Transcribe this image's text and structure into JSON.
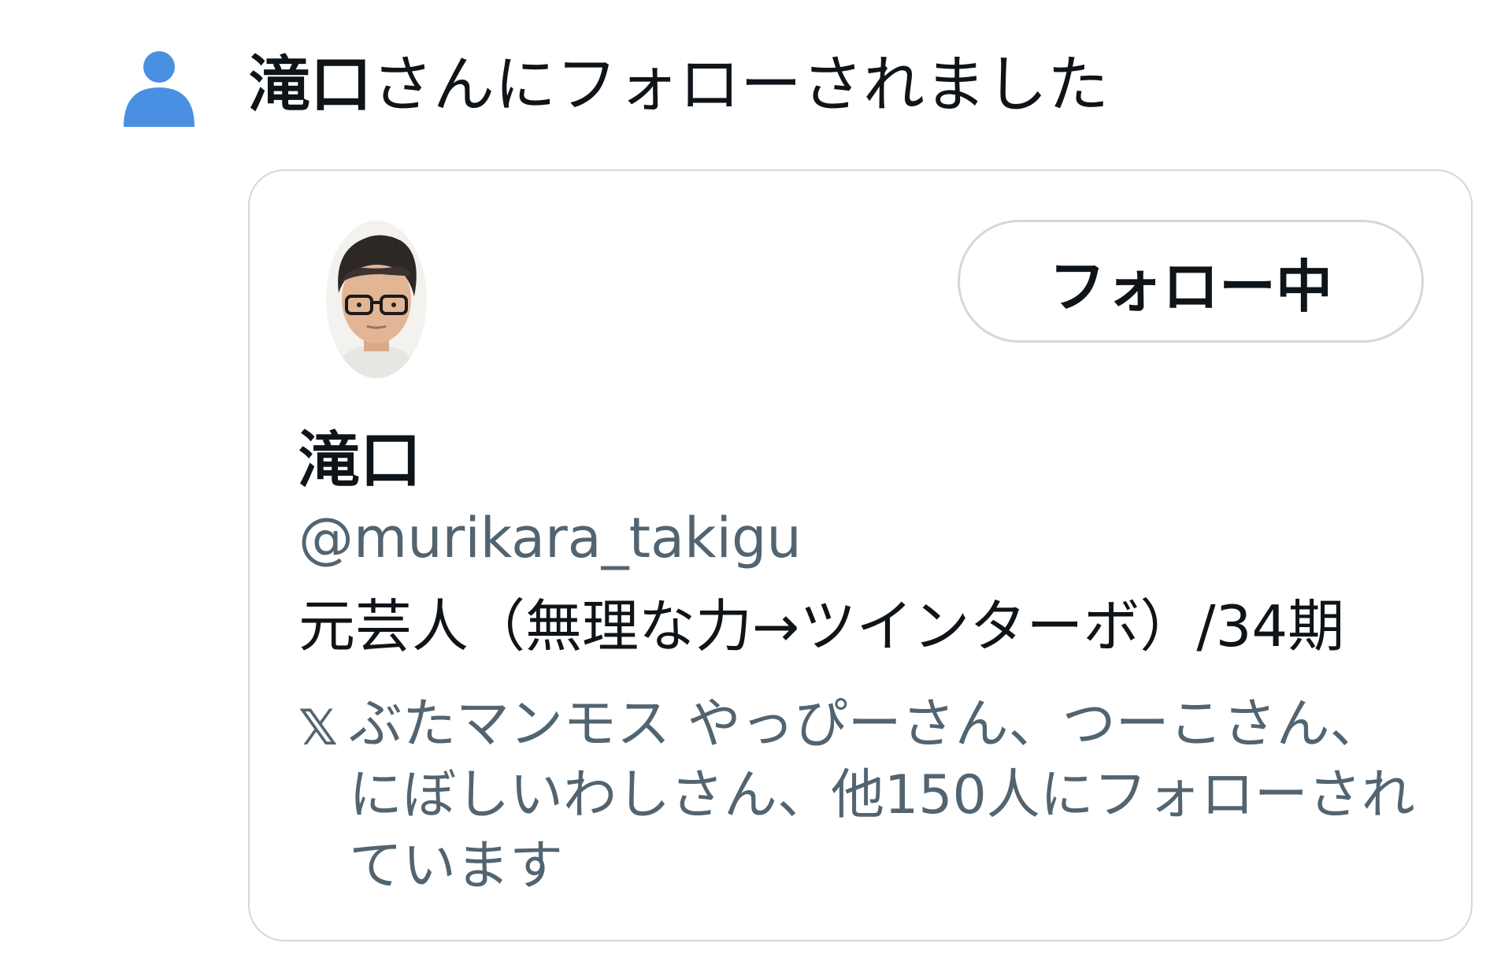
{
  "notification": {
    "icon": "person-icon",
    "header_name": "滝口",
    "header_text": "さんにフォローされました"
  },
  "user_card": {
    "avatar": "profile-photo",
    "follow_button_label": "フォロー中",
    "display_name": "滝口",
    "handle": "@murikara_takigu",
    "bio": "元芸人（無理な力→ツインターボ）/34期",
    "mutuals_icon": "x-logo-icon",
    "mutuals_text": "ぶたマンモス やっぴーさん、つーこさん、にぼしいわしさん、他150人にフォローされています"
  },
  "colors": {
    "accent": "#4a90e2",
    "primary_text": "#0f1419",
    "secondary_text": "#536471",
    "border": "#cfd9de"
  }
}
